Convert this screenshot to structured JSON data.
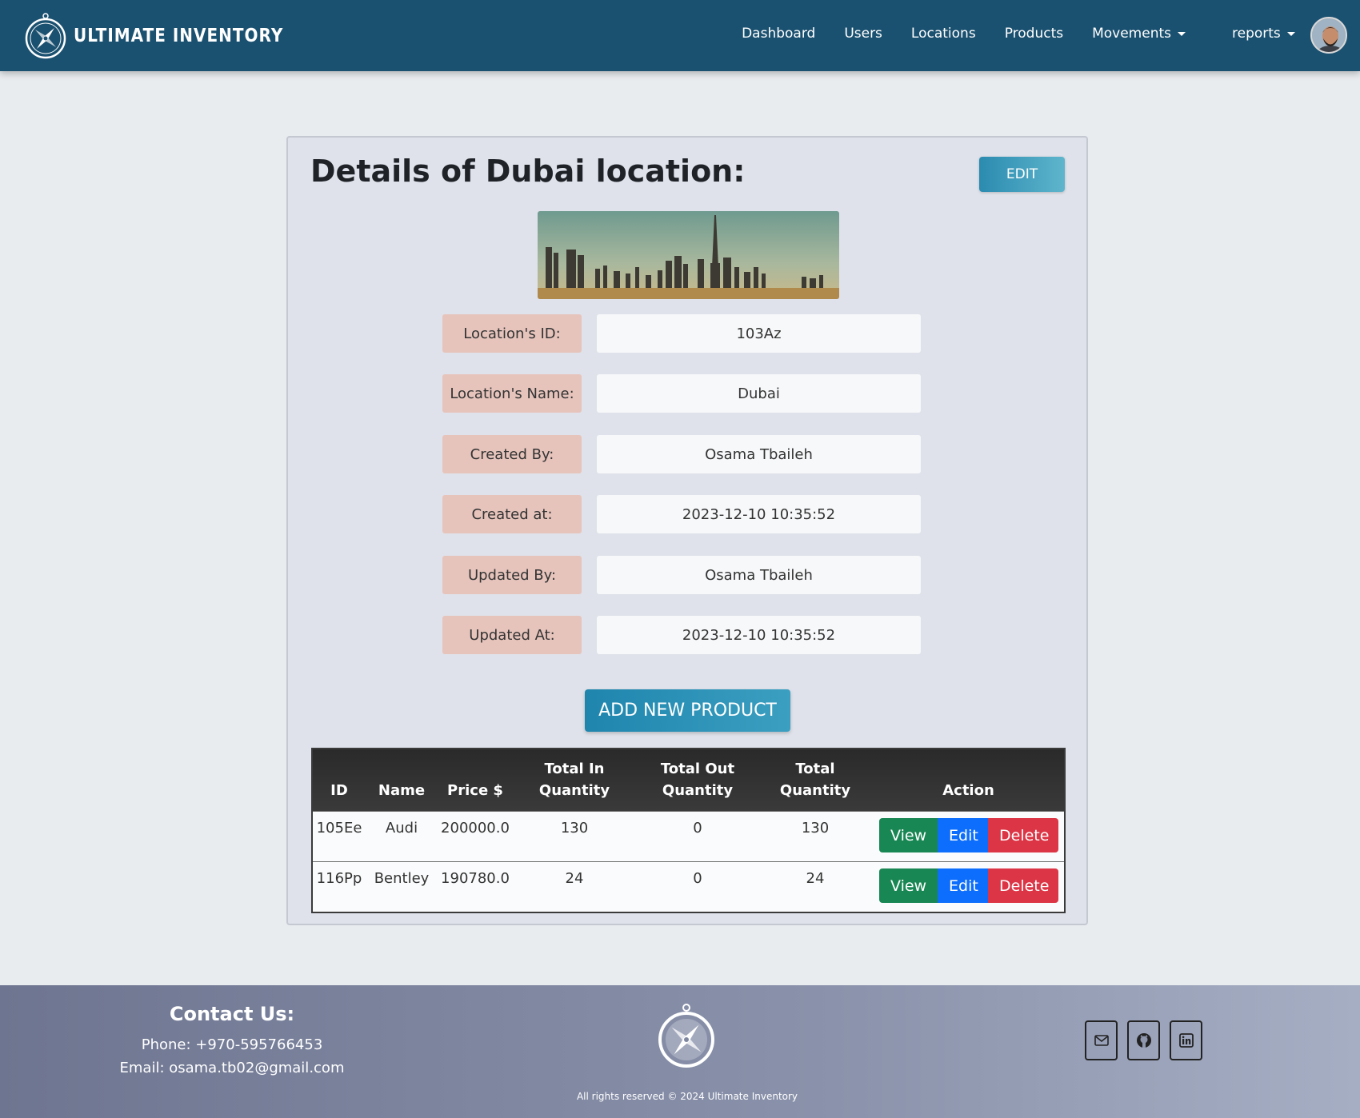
{
  "navbar": {
    "brand": "ULTIMATE INVENTORY",
    "links": [
      "Dashboard",
      "Users",
      "Locations",
      "Products",
      "Movements",
      "reports"
    ]
  },
  "details": {
    "title": "Details of Dubai location:",
    "edit_label": "EDIT",
    "fields": [
      {
        "label": "Location's ID:",
        "value": "103Az"
      },
      {
        "label": "Location's Name:",
        "value": "Dubai"
      },
      {
        "label": "Created By:",
        "value": "Osama Tbaileh"
      },
      {
        "label": "Created at:",
        "value": "2023-12-10 10:35:52"
      },
      {
        "label": "Updated By:",
        "value": "Osama Tbaileh"
      },
      {
        "label": "Updated At:",
        "value": "2023-12-10 10:35:52"
      }
    ],
    "add_product_label": "ADD NEW PRODUCT"
  },
  "table": {
    "headers": [
      "ID",
      "Name",
      "Price $",
      "Total In Quantity",
      "Total Out Quantity",
      "Total Quantity",
      "Action"
    ],
    "header_lines": {
      "in_1": "Total In",
      "in_2": "Quantity",
      "out_1": "Total Out",
      "out_2": "Quantity",
      "total_1": "Total",
      "total_2": "Quantity"
    },
    "rows": [
      {
        "id": "105Ee",
        "name": "Audi",
        "price": "200000.0",
        "in": "130",
        "out": "0",
        "total": "130"
      },
      {
        "id": "116Pp",
        "name": "Bentley",
        "price": "190780.0",
        "in": "24",
        "out": "0",
        "total": "24"
      }
    ],
    "actions": {
      "view": "View",
      "edit": "Edit",
      "delete": "Delete"
    }
  },
  "footer": {
    "contact_title": "Contact Us:",
    "phone": "Phone: +970-595766453",
    "email": "Email: osama.tb02@gmail.com",
    "copyright": "All rights reserved © 2024 Ultimate Inventory"
  },
  "colors": {
    "navbar": "#1b5170",
    "label_bg": "#e6c4bc",
    "view": "#198754",
    "edit": "#0d6efd",
    "delete": "#dc3545"
  }
}
